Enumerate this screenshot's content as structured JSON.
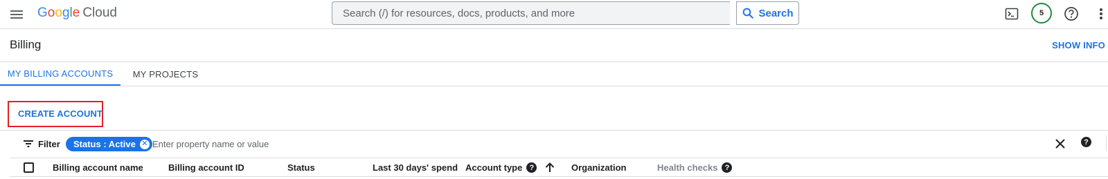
{
  "header": {
    "logo": {
      "google": "Google",
      "cloud": "Cloud"
    },
    "search": {
      "placeholder": "Search (/) for resources, docs, products, and more",
      "button_label": "Search"
    },
    "avatar_text": "5",
    "icons": [
      "menu-icon",
      "terminal-icon",
      "help-circle-icon",
      "more-vert-icon"
    ]
  },
  "page": {
    "title": "Billing",
    "show_info": "SHOW INFO"
  },
  "tabs": [
    {
      "label": "MY BILLING ACCOUNTS",
      "active": true
    },
    {
      "label": "MY PROJECTS",
      "active": false
    }
  ],
  "actions": {
    "create_account": "CREATE ACCOUNT"
  },
  "filter": {
    "label": "Filter",
    "chip": "Status : Active",
    "placeholder": "Enter property name or value"
  },
  "table": {
    "columns": [
      "Billing account name",
      "Billing account ID",
      "Status",
      "Last 30 days' spend",
      "Account type",
      "Organization",
      "Health checks"
    ]
  },
  "colors": {
    "accent": "#1a73e8",
    "highlight": "#e41e26",
    "avatar_ring": "#1e8e3e"
  }
}
